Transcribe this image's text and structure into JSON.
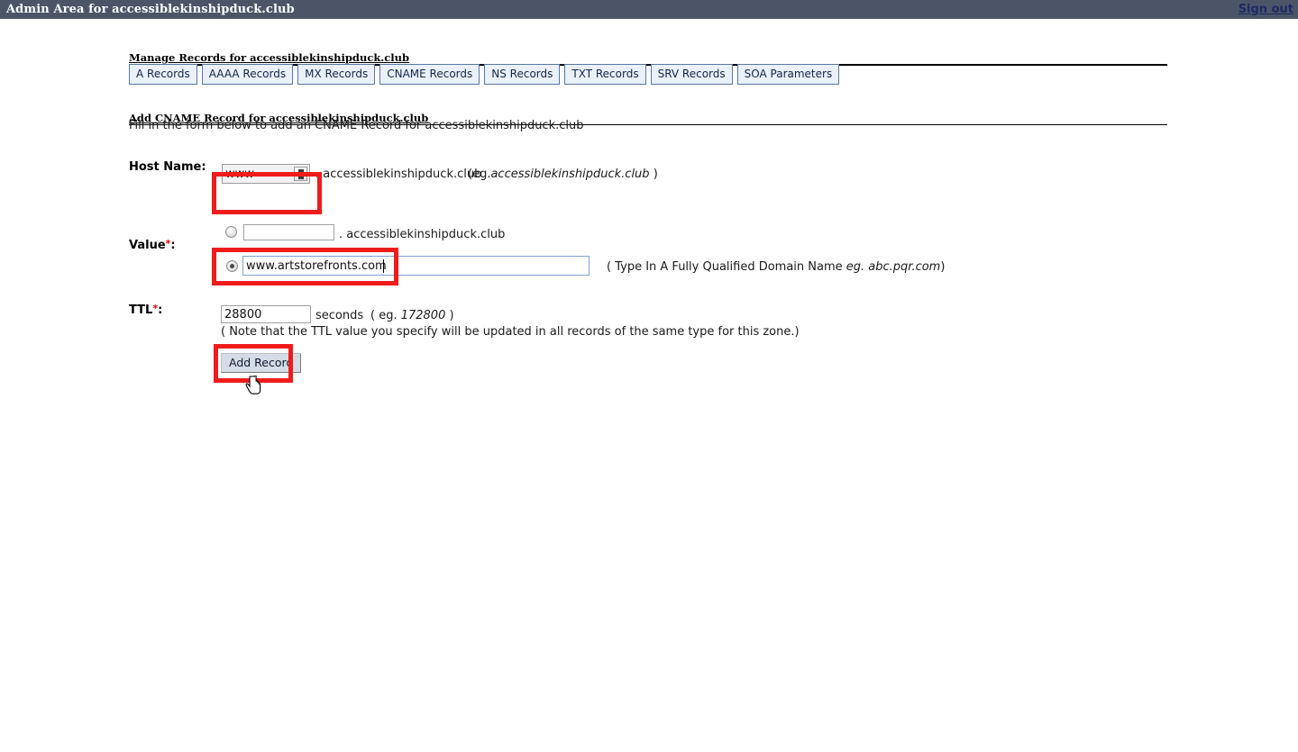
{
  "titlebar": {
    "app_title": "Admin Area for accessiblekinshipduck.club",
    "signout_label": "Sign out"
  },
  "manage": {
    "heading": "Manage Records for accessiblekinshipduck.club",
    "tabs": [
      {
        "label": "A Records"
      },
      {
        "label": "AAAA Records"
      },
      {
        "label": "MX Records"
      },
      {
        "label": "CNAME Records"
      },
      {
        "label": "NS Records"
      },
      {
        "label": "TXT Records"
      },
      {
        "label": "SRV Records"
      },
      {
        "label": "SOA Parameters"
      }
    ]
  },
  "form": {
    "heading": "Add CNAME Record for accessiblekinshipduck.club",
    "subtitle": "Fill in the form below to add an CNAME Record for accessiblekinshipduck.club",
    "host": {
      "label": "Host Name",
      "label_colon": ":",
      "value": "www",
      "placeholder": "",
      "suffix": ". accessiblekinshipduck.club",
      "hint": "(eg.",
      "hint_italic": "accessiblekinshipduck.club",
      "hint_end": " )"
    },
    "value": {
      "label": "Value",
      "required_mark": "*",
      "label_colon": ":",
      "option_sub": {
        "value": "",
        "placeholder": "",
        "suffix": ". accessiblekinshipduck.club",
        "selected": "false"
      },
      "option_fqdn": {
        "value": "www.artstorefronts.com",
        "placeholder": "",
        "selected": "true",
        "hint_open": "( Type In A Fully Qualified Domain Name ",
        "hint_italic": "eg. abc.pqr.com",
        "hint_close": ")"
      }
    },
    "ttl": {
      "label": "TTL",
      "required_mark": "*",
      "label_colon": ":",
      "value": "28800",
      "unit": "seconds",
      "hint_open": "( eg. ",
      "hint_italic": "172800",
      "hint_close": " )",
      "note": "( Note that the TTL value you specify will be updated in all records of the same type for this zone.)"
    },
    "submit_label": "Add Record"
  },
  "colors": {
    "titlebar_bg": "#4c5568",
    "link": "#1c2a63",
    "tab_bg": "#eaf1fa",
    "tab_border": "#5878a8",
    "annotation": "#ef1c1c",
    "required": "#d00000",
    "focus_border": "#7da2d6"
  },
  "icons": {
    "autofill": "autofill-icon",
    "cursor": "hand-pointer-cursor"
  }
}
